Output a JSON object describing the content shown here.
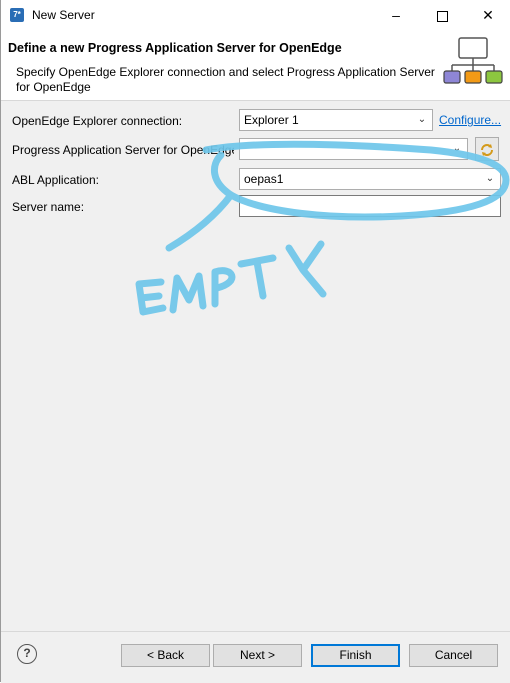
{
  "window": {
    "title": "New Server",
    "icon": "eclipse-app-icon"
  },
  "header": {
    "title": "Define a new Progress Application Server for OpenEdge",
    "description": "Specify OpenEdge Explorer connection and select Progress Application Server for OpenEdge",
    "graphic_icon": "server-network-icon"
  },
  "form": {
    "explorer_label": "OpenEdge Explorer connection:",
    "explorer_value": "Explorer 1",
    "configure_link": "Configure...",
    "pas_label": "Progress Application Server for OpenEdge:",
    "pas_value": "",
    "abl_label": "ABL Application:",
    "abl_value": "oepas1",
    "server_name_label": "Server name:",
    "server_name_value": ""
  },
  "annotation": {
    "text": "EMPTY",
    "color": "#6ec6ea"
  },
  "buttons": {
    "back": "< Back",
    "next": "Next >",
    "finish": "Finish",
    "cancel": "Cancel",
    "help_glyph": "?"
  },
  "colors": {
    "link": "#0066cc",
    "primary_border": "#0078d7",
    "graphic_box1": "#8e86d6",
    "graphic_box2": "#f29a16",
    "graphic_box3": "#8cc63f"
  }
}
